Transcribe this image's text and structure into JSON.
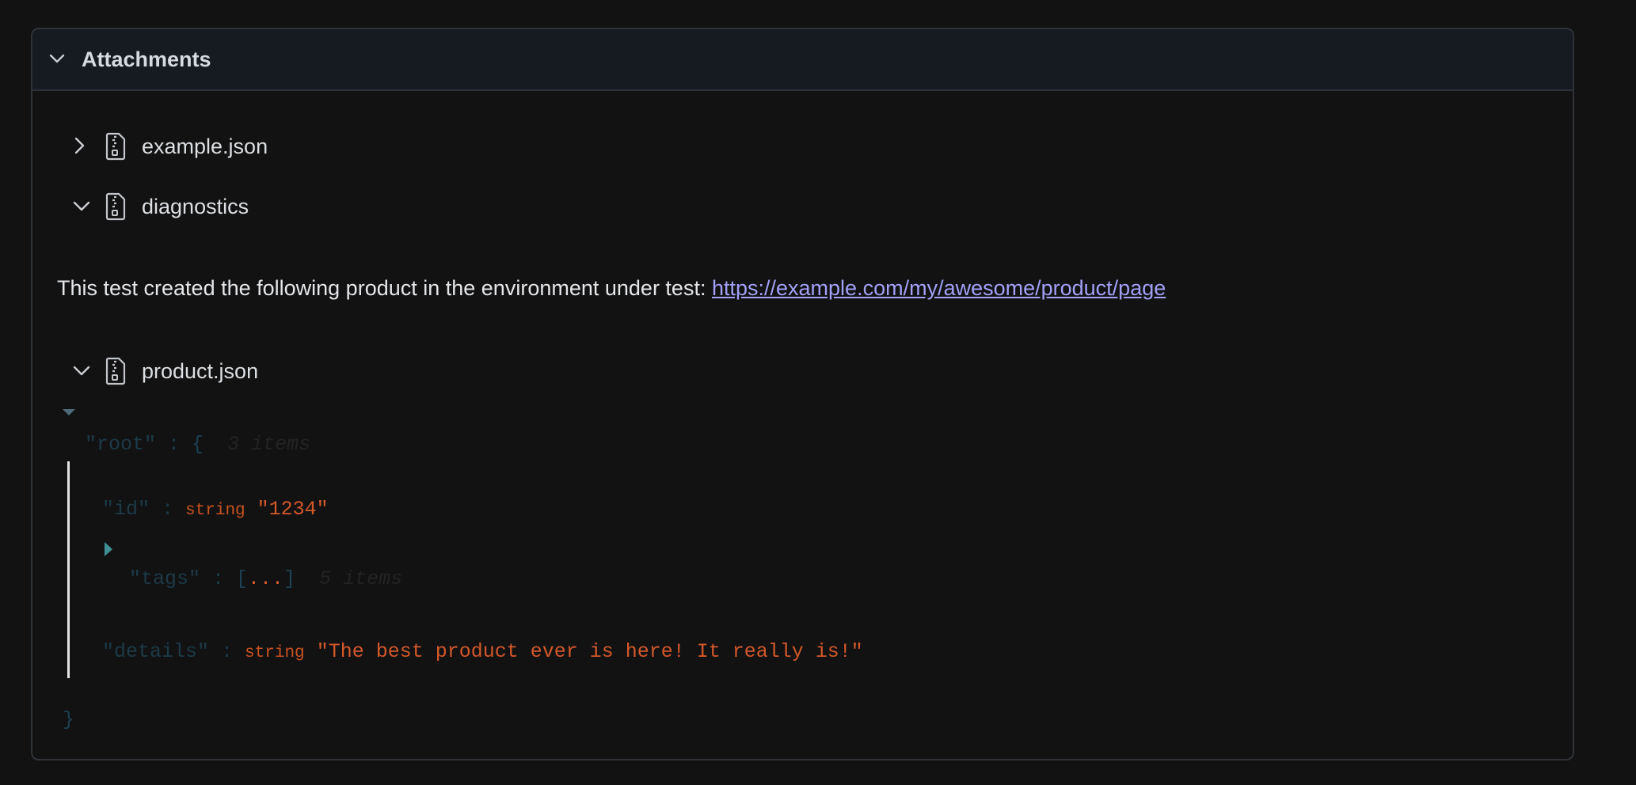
{
  "section": {
    "title": "Attachments",
    "icon": "chevron-down-icon"
  },
  "attachments": [
    {
      "name": "example.json",
      "expanded": false,
      "icon": "file-archive-icon"
    },
    {
      "name": "diagnostics",
      "expanded": true,
      "icon": "file-archive-icon"
    },
    {
      "name": "product.json",
      "expanded": true,
      "icon": "file-archive-icon"
    }
  ],
  "diagnostics": {
    "text": "This test created the following product in the environment under test: ",
    "link_text": "https://example.com/my/awesome/product/page"
  },
  "json_viewer": {
    "root_key": "\"root\"",
    "colon": " : ",
    "open_brace": "{",
    "root_count": "3 items",
    "close_brace": "}",
    "entries": [
      {
        "key": "\"id\"",
        "type": "string",
        "value": "\"1234\""
      },
      {
        "key": "\"tags\"",
        "open": "[",
        "dots": "...",
        "close": "]",
        "count": "5 items"
      },
      {
        "key": "\"details\"",
        "type": "string",
        "value": "\"The best product ever is here! It really is!\""
      }
    ]
  },
  "colors": {
    "background": "#121212",
    "header": "#161a21",
    "border": "#2f3237",
    "link": "#a2a0f7",
    "string_value": "#d3582a"
  }
}
